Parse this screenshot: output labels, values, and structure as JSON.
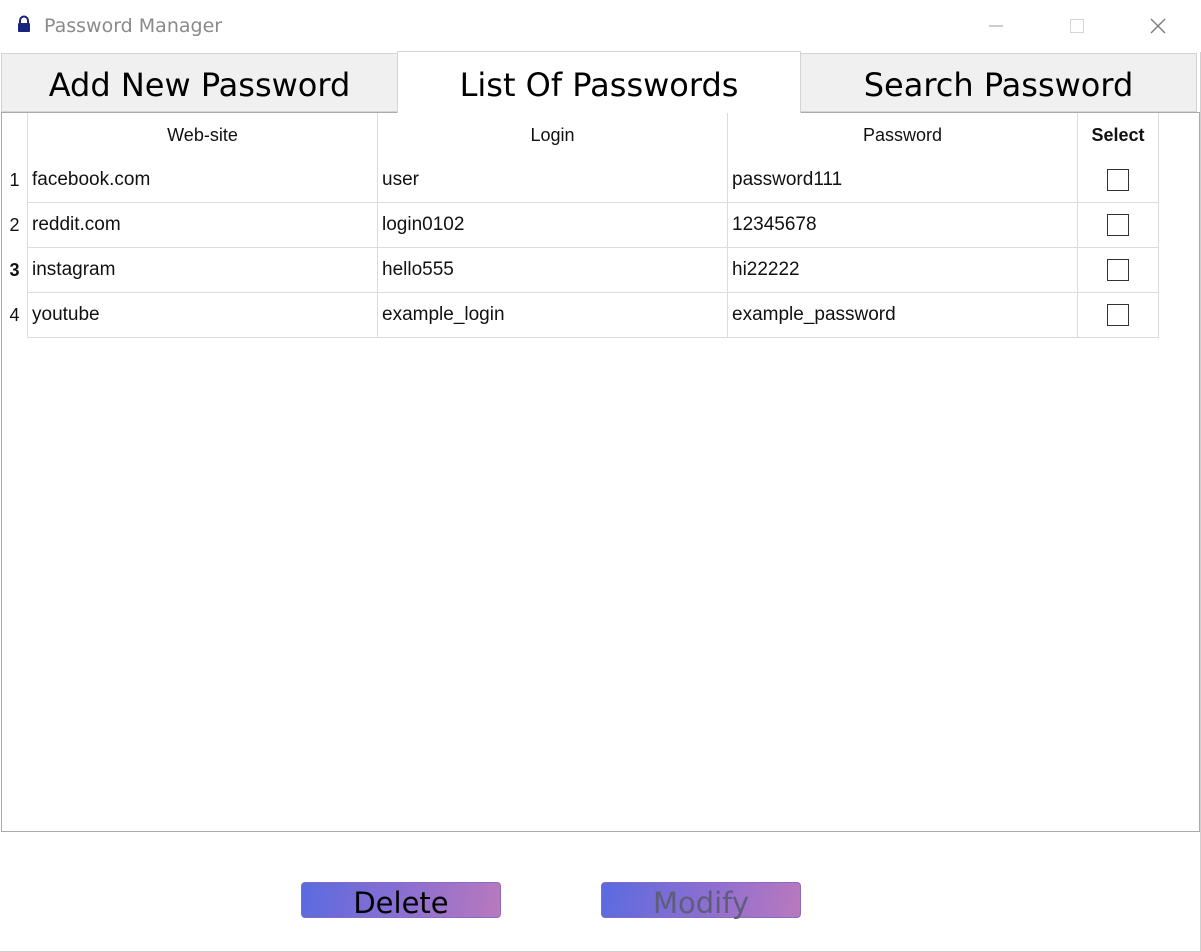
{
  "window": {
    "title": "Password Manager",
    "icon": "lock-icon"
  },
  "tabs": [
    {
      "label": "Add New Password",
      "active": false
    },
    {
      "label": "List Of Passwords",
      "active": true
    },
    {
      "label": "Search Password",
      "active": false
    }
  ],
  "table": {
    "columns": [
      "Web-site",
      "Login",
      "Password",
      "Select"
    ],
    "rows": [
      {
        "num": "1",
        "site": "facebook.com",
        "login": "user",
        "password": "password111",
        "selected": false
      },
      {
        "num": "2",
        "site": "reddit.com",
        "login": "login0102",
        "password": "12345678",
        "selected": false
      },
      {
        "num": "3",
        "site": "instagram",
        "login": "hello555",
        "password": "hi22222",
        "selected": false
      },
      {
        "num": "4",
        "site": "youtube",
        "login": "example_login",
        "password": "example_password",
        "selected": false
      }
    ]
  },
  "buttons": {
    "delete": "Delete",
    "modify": "Modify"
  },
  "colors": {
    "button_gradient_start": "#5a6be0",
    "button_gradient_end": "#b979bd"
  }
}
